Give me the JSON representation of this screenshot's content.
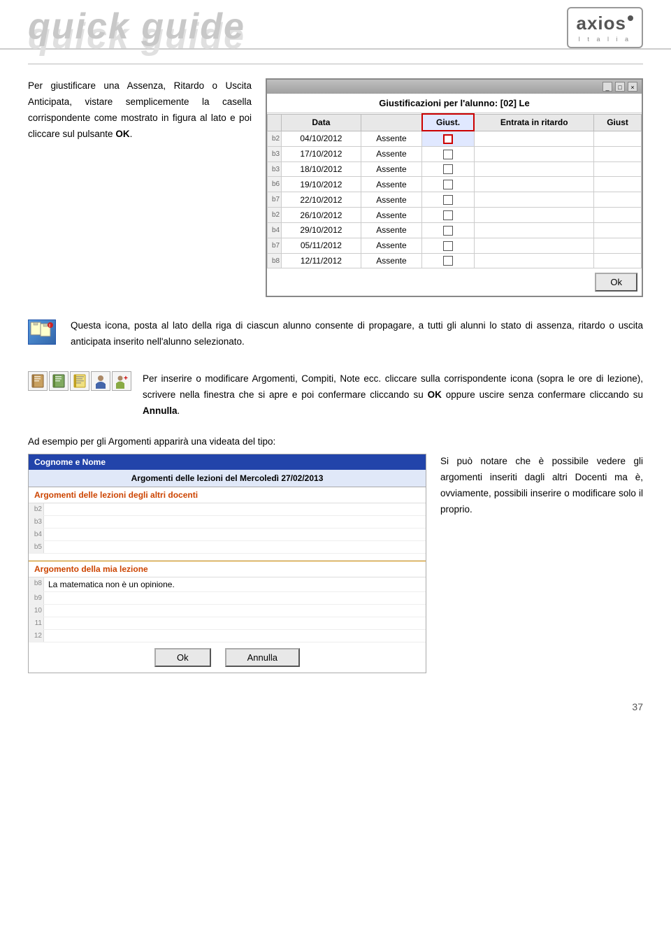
{
  "header": {
    "title_main": "quick guide",
    "title_shadow": "quick guide",
    "logo_text": "axios",
    "logo_sub": "I t a l i a",
    "logo_dot": "·"
  },
  "section1": {
    "paragraph": "Per giustificare una Assenza, Ritardo o Uscita Anticipata, vistare semplicemente la casella corrispondente come mostrato in figura al lato e poi cliccare sul pulsante ",
    "bold": "OK",
    "after": "."
  },
  "table": {
    "title": "Giustificazioni per l'alunno: [02] Le",
    "columns": [
      "Data",
      "",
      "Giust.",
      "Entrata in ritardo",
      "Giust"
    ],
    "rows": [
      {
        "num": "b2",
        "date": "04/10/2012",
        "status": "Assente",
        "checked": true
      },
      {
        "num": "b3",
        "date": "17/10/2012",
        "status": "Assente",
        "checked": false
      },
      {
        "num": "b3",
        "date": "18/10/2012",
        "status": "Assente",
        "checked": false
      },
      {
        "num": "b6",
        "date": "19/10/2012",
        "status": "Assente",
        "checked": false
      },
      {
        "num": "b7",
        "date": "22/10/2012",
        "status": "Assente",
        "checked": false
      },
      {
        "num": "b2",
        "date": "26/10/2012",
        "status": "Assente",
        "checked": false
      },
      {
        "num": "b4",
        "date": "29/10/2012",
        "status": "Assente",
        "checked": false
      },
      {
        "num": "b7",
        "date": "05/11/2012",
        "status": "Assente",
        "checked": false
      },
      {
        "num": "b8",
        "date": "12/11/2012",
        "status": "Assente",
        "checked": false
      }
    ],
    "ok_btn": "Ok"
  },
  "section2": {
    "text": "Questa icona, posta al lato della riga di ciascun alunno consente di propagare, a tutti gli alunni lo stato di assenza, ritardo o uscita anticipata inserito nell'alunno selezionato."
  },
  "section3": {
    "text_before": "Per inserire o modificare Argomenti, Compiti, Note ecc. cliccare sulla corrispondente icona (sopra le ore di lezione), scrivere nella finestra che si apre e poi confermare cliccando su ",
    "bold1": "OK",
    "text_middle": " oppure uscire senza confermare cliccando su ",
    "bold2": "Annulla",
    "text_after": "."
  },
  "section4": {
    "intro": "Ad esempio per gli Argomenti apparirà una videata del tipo:",
    "window": {
      "titlebar": "Cognome e Nome",
      "header": "Argomenti delle lezioni del  Mercoledì 27/02/2013",
      "section1_header": "Argomenti delle lezioni degli altri docenti",
      "rows_other": [
        {
          "num": "b2",
          "content": ""
        },
        {
          "num": "b3",
          "content": ""
        },
        {
          "num": "b4",
          "content": ""
        },
        {
          "num": "b5",
          "content": ""
        }
      ],
      "section2_header": "Argomento della mia lezione",
      "my_lesson_text": "La matematica non è un opinione.",
      "rows_mine": [
        {
          "num": "b8",
          "content": ""
        },
        {
          "num": "b9",
          "content": ""
        },
        {
          "num": "b10",
          "content": ""
        }
      ],
      "btn_ok": "Ok",
      "btn_annulla": "Annulla",
      "bottom_rows": [
        {
          "num": "11",
          "content": ""
        },
        {
          "num": "12",
          "content": ""
        }
      ]
    },
    "right_text": "Si può notare che è possibile vedere gli argomenti inseriti dagli altri Docenti ma è, ovviamente, possibili inserire o modificare solo il proprio."
  },
  "footer": {
    "page_number": "37"
  }
}
